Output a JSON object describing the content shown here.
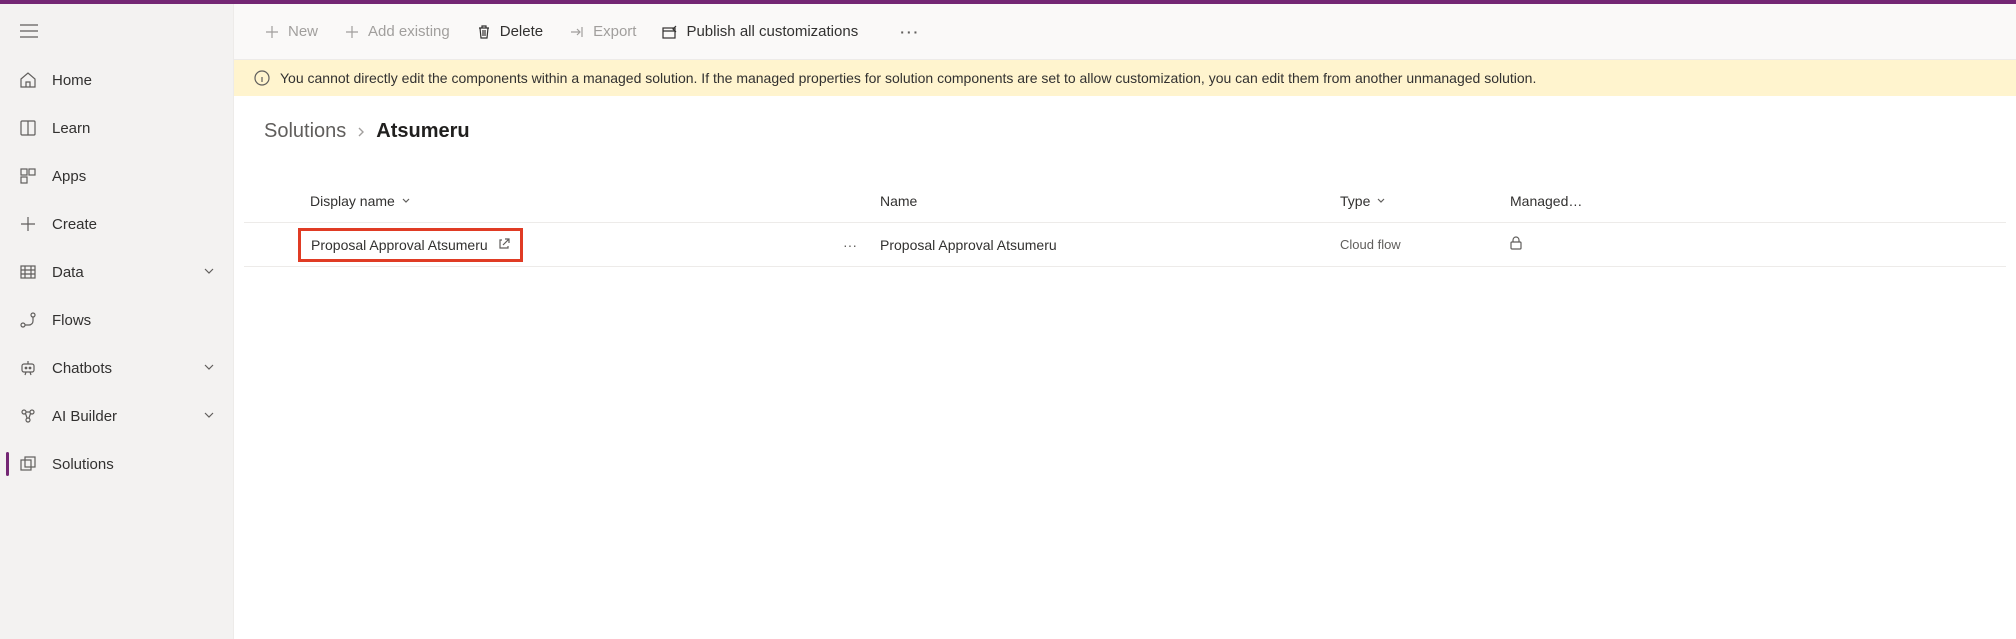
{
  "sidebar": {
    "items": [
      {
        "label": "Home"
      },
      {
        "label": "Learn"
      },
      {
        "label": "Apps"
      },
      {
        "label": "Create"
      },
      {
        "label": "Data"
      },
      {
        "label": "Flows"
      },
      {
        "label": "Chatbots"
      },
      {
        "label": "AI Builder"
      },
      {
        "label": "Solutions"
      }
    ]
  },
  "commands": {
    "new": "New",
    "add_existing": "Add existing",
    "delete": "Delete",
    "export": "Export",
    "publish": "Publish all customizations"
  },
  "banner": {
    "text": "You cannot directly edit the components within a managed solution. If the managed properties for solution components are set to allow customization, you can edit them from another unmanaged solution."
  },
  "breadcrumb": {
    "root": "Solutions",
    "current": "Atsumeru"
  },
  "grid": {
    "headers": {
      "display": "Display name",
      "name": "Name",
      "type": "Type",
      "managed": "Managed…"
    },
    "rows": [
      {
        "display": "Proposal Approval Atsumeru",
        "name": "Proposal Approval Atsumeru",
        "type": "Cloud flow",
        "managed_icon": "lock"
      }
    ]
  }
}
